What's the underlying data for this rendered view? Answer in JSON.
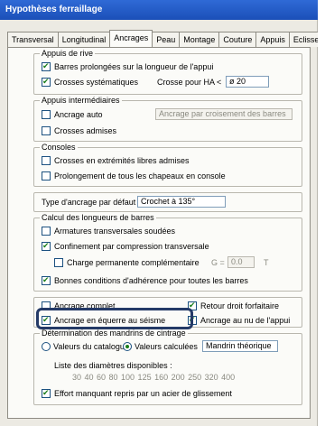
{
  "window": {
    "title": "Hypothèses ferraillage"
  },
  "tabs": [
    {
      "label": "Transversal"
    },
    {
      "label": "Longitudinal"
    },
    {
      "label": "Ancrages",
      "active": true
    },
    {
      "label": "Peau"
    },
    {
      "label": "Montage"
    },
    {
      "label": "Couture"
    },
    {
      "label": "Appuis"
    },
    {
      "label": "Eclisses"
    }
  ],
  "appuis_rive": {
    "title": "Appuis de rive",
    "barres_prolongees": {
      "label": "Barres prolongées sur la longueur de l'appui",
      "checked": true
    },
    "crosses_systematiques": {
      "label": "Crosses systématiques",
      "checked": true
    },
    "crosse_pour_ha_label": "Crosse pour HA <",
    "crosse_pour_ha_value": "ø 20"
  },
  "appuis_intermediaires": {
    "title": "Appuis intermédiaires",
    "ancrage_auto": {
      "label": "Ancrage auto",
      "checked": false
    },
    "ancrage_auto_value": "Ancrage par croisement des barres",
    "crosses_admises": {
      "label": "Crosses admises",
      "checked": false
    }
  },
  "consoles": {
    "title": "Consoles",
    "crosses_extremites": {
      "label": "Crosses en extrémités libres admises",
      "checked": false
    },
    "prolongement": {
      "label": "Prolongement de tous les chapeaux en console",
      "checked": false
    }
  },
  "type_ancrage": {
    "label": "Type d'ancrage par défaut :",
    "value": "Crochet à 135°"
  },
  "calcul": {
    "title": "Calcul des longueurs de barres",
    "armatures_soudees": {
      "label": "Armatures transversales soudées",
      "checked": false
    },
    "confinement": {
      "label": "Confinement par compression transversale",
      "checked": true
    },
    "charge_permanente": {
      "label": "Charge permanente complémentaire",
      "checked": false
    },
    "g_label": "G =",
    "g_value": "0.0",
    "g_unit": "T",
    "bonnes_conditions": {
      "label": "Bonnes conditions d'adhérence pour toutes les barres",
      "checked": true
    }
  },
  "options": {
    "ancrage_complet": {
      "label": "Ancrage complet",
      "checked": false
    },
    "retour_droit": {
      "label": "Retour droit forfaitaire",
      "checked": true
    },
    "ancrage_equerre": {
      "label": "Ancrage en équerre au séisme",
      "checked": true
    },
    "ancrage_nu_appui": {
      "label": "Ancrage au nu de l'appui",
      "checked": true
    }
  },
  "mandrins": {
    "title": "Détermination des mandrins de cintrage",
    "valeurs_catalogue": {
      "label": "Valeurs du catalogue",
      "checked": false
    },
    "valeurs_calculees": {
      "label": "Valeurs calculées",
      "checked": true
    },
    "mandrin_value": "Mandrin théorique",
    "liste_label": "Liste des diamètres disponibles :",
    "liste_values": "30  40  60  80 100 125 160 200 250 320 400",
    "effort_manquant": {
      "label": "Effort manquant repris par un acier de glissement",
      "checked": true
    }
  },
  "colors": {
    "title_bar": "#1b4fb8",
    "highlight": "#243a67",
    "check": "#1a7d1a"
  }
}
